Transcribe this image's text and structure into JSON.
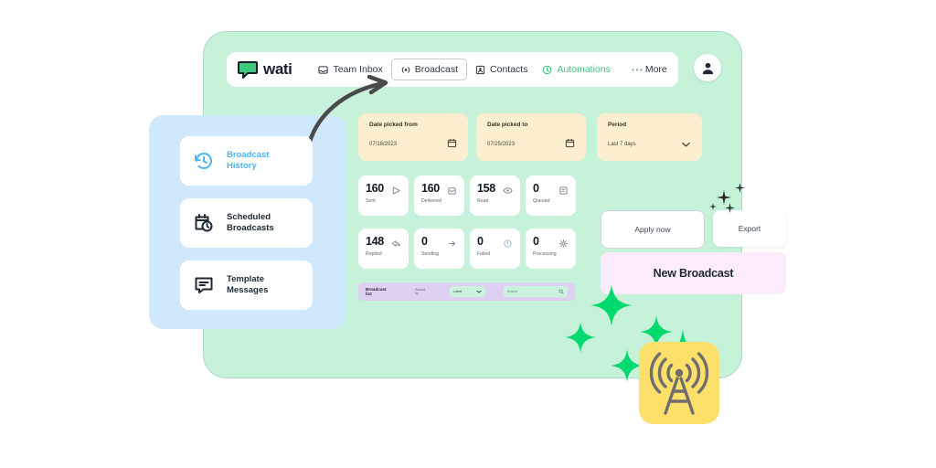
{
  "brand": {
    "name": "wati",
    "logo_icon": "chat-bubble-icon"
  },
  "nav": {
    "items": [
      {
        "label": "Team Inbox",
        "icon": "inbox-icon",
        "active": false
      },
      {
        "label": "Broadcast",
        "icon": "broadcast-icon",
        "active": true
      },
      {
        "label": "Contacts",
        "icon": "contacts-icon",
        "active": false
      },
      {
        "label": "Automations",
        "icon": "automations-icon",
        "active": false
      },
      {
        "label": "More",
        "icon": "ellipsis-icon",
        "active": false
      }
    ],
    "avatar_icon": "user-avatar-icon"
  },
  "sidebar": {
    "items": [
      {
        "label_line1": "Broadcast",
        "label_line2": "History",
        "icon": "history-clock-icon",
        "active": true
      },
      {
        "label_line1": "Scheduled",
        "label_line2": "Broadcasts",
        "icon": "calendar-clock-icon",
        "active": false
      },
      {
        "label_line1": "Template",
        "label_line2": "Messages",
        "icon": "message-template-icon",
        "active": false
      }
    ]
  },
  "filters": [
    {
      "title": "Date picked from",
      "value": "07/18/2023",
      "icon": "calendar-icon"
    },
    {
      "title": "Date picked to",
      "value": "07/25/2023",
      "icon": "calendar-icon"
    },
    {
      "title": "Period",
      "value": "Last 7 days",
      "icon": "chevron-down-icon"
    }
  ],
  "stats": [
    {
      "value": "160",
      "label": "Sent",
      "icon": "send-icon"
    },
    {
      "value": "160",
      "label": "Delivered",
      "icon": "delivered-icon"
    },
    {
      "value": "158",
      "label": "Read",
      "icon": "eye-icon"
    },
    {
      "value": "0",
      "label": "Queued",
      "icon": "queue-icon"
    },
    {
      "value": "148",
      "label": "Replied",
      "icon": "reply-icon"
    },
    {
      "value": "0",
      "label": "Sending",
      "icon": "sending-icon"
    },
    {
      "value": "0",
      "label": "Failed",
      "icon": "failed-icon"
    },
    {
      "value": "0",
      "label": "Processing",
      "icon": "processing-icon"
    }
  ],
  "actions": {
    "apply_label": "Apply now",
    "export_label": "Export",
    "new_broadcast_label": "New Broadcast"
  },
  "list_toolbar": {
    "title": "Broadcast list",
    "subtitle": "Sorted by",
    "sort_value": "Latest",
    "search_placeholder": "Search",
    "search_icon": "search-icon",
    "chevron_icon": "chevron-down-icon"
  },
  "badge": {
    "icon": "broadcast-tower-icon"
  },
  "colors": {
    "panel_mint": "#c6f2da",
    "sidebar_blue": "#cfe8fb",
    "filter_cream": "#fcefcf",
    "new_broadcast_pink": "#fcebfa",
    "toolbar_purple": "#ddd0f0",
    "badge_yellow": "#fde06a",
    "brand_green": "#3fc77e",
    "active_blue": "#4db4f5",
    "sparkle_green": "#00d06a"
  }
}
